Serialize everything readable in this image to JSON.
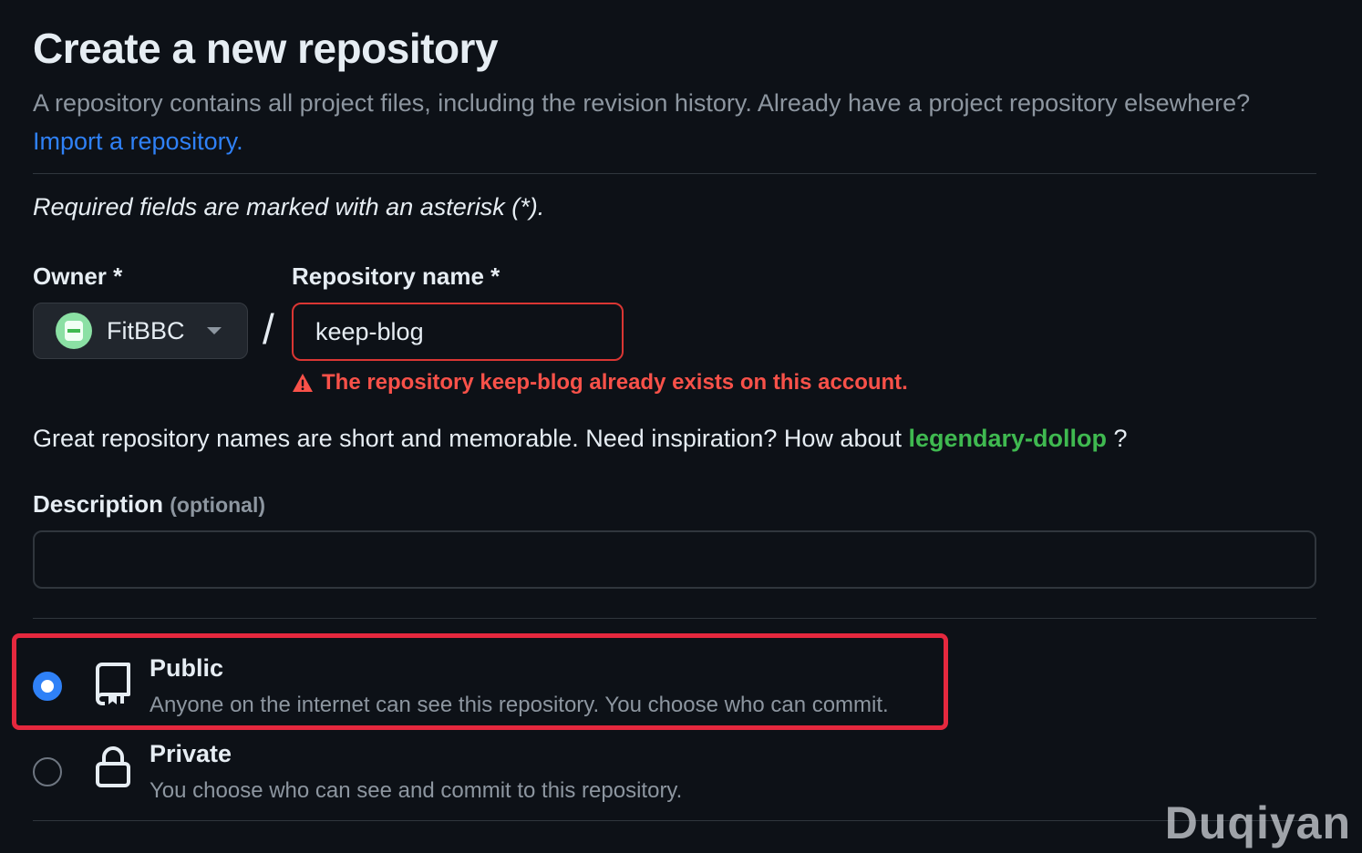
{
  "page": {
    "title": "Create a new repository",
    "intro_text": "A repository contains all project files, including the revision history. Already have a project repository elsewhere? ",
    "import_link": "Import a repository.",
    "required_note": "Required fields are marked with an asterisk (*)."
  },
  "owner": {
    "label": "Owner *",
    "value": "FitBBC",
    "avatar_color": "#8be0a4"
  },
  "separator": "/",
  "repo_name": {
    "label": "Repository name *",
    "value": "keep-blog",
    "error": "The repository keep-blog already exists on this account."
  },
  "suggestion": {
    "prefix": "Great repository names are short and memorable. Need inspiration? How about ",
    "name": "legendary-dollop",
    "suffix": " ?"
  },
  "description": {
    "label": "Description",
    "optional": "(optional)",
    "value": "",
    "placeholder": ""
  },
  "visibility": {
    "public": {
      "title": "Public",
      "desc": "Anyone on the internet can see this repository. You choose who can commit.",
      "selected": true,
      "icon": "repo-icon"
    },
    "private": {
      "title": "Private",
      "desc": "You choose who can see and commit to this repository.",
      "selected": false,
      "icon": "lock-icon"
    }
  },
  "colors": {
    "background": "#0d1117",
    "link": "#2f81f7",
    "error": "#f85149",
    "success": "#3fb950",
    "highlight": "#e5283e"
  },
  "watermark": "Duqiyan"
}
